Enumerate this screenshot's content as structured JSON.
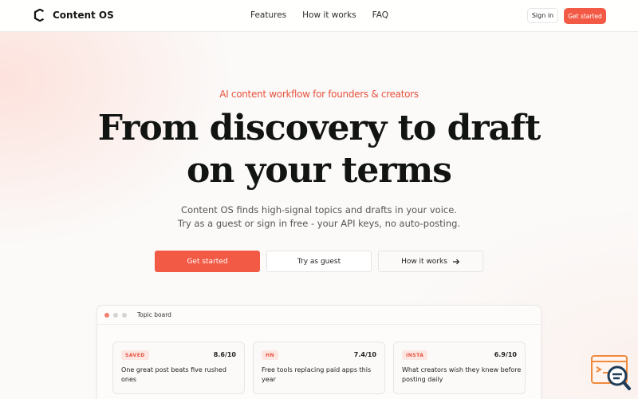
{
  "brand": {
    "name": "Content OS"
  },
  "nav": {
    "links": [
      "Features",
      "How it works",
      "FAQ"
    ],
    "sign_in": "Sign in",
    "cta": "Get started"
  },
  "hero": {
    "eyebrow": "AI content workflow for founders & creators",
    "headline_line1": "From discovery to draft",
    "headline_line2": "on your terms",
    "sub_line1": "Content OS finds high-signal topics and drafts in your voice.",
    "sub_line2": "Try as a guest or sign in free - your API keys, no auto-posting.",
    "buttons": {
      "primary": "Get started",
      "guest": "Try as guest",
      "how": "How it works"
    }
  },
  "topic_board": {
    "title": "Topic board",
    "cards": [
      {
        "tag": "SAVED",
        "score": "8.6/10",
        "title": "One great post beats five rushed ones"
      },
      {
        "tag": "HN",
        "score": "7.4/10",
        "title": "Free tools replacing paid apps this year"
      },
      {
        "tag": "INSTA",
        "score": "6.9/10",
        "title": "What creators wish they knew before posting daily"
      }
    ]
  },
  "colors": {
    "accent": "#f35a45",
    "tag_bg": "#fde7e3",
    "text_dark": "#121412"
  },
  "icons": {
    "brand_logo": "c-logo-icon",
    "arrow": "arrow-right-icon",
    "widget": "chat-search-icon"
  }
}
